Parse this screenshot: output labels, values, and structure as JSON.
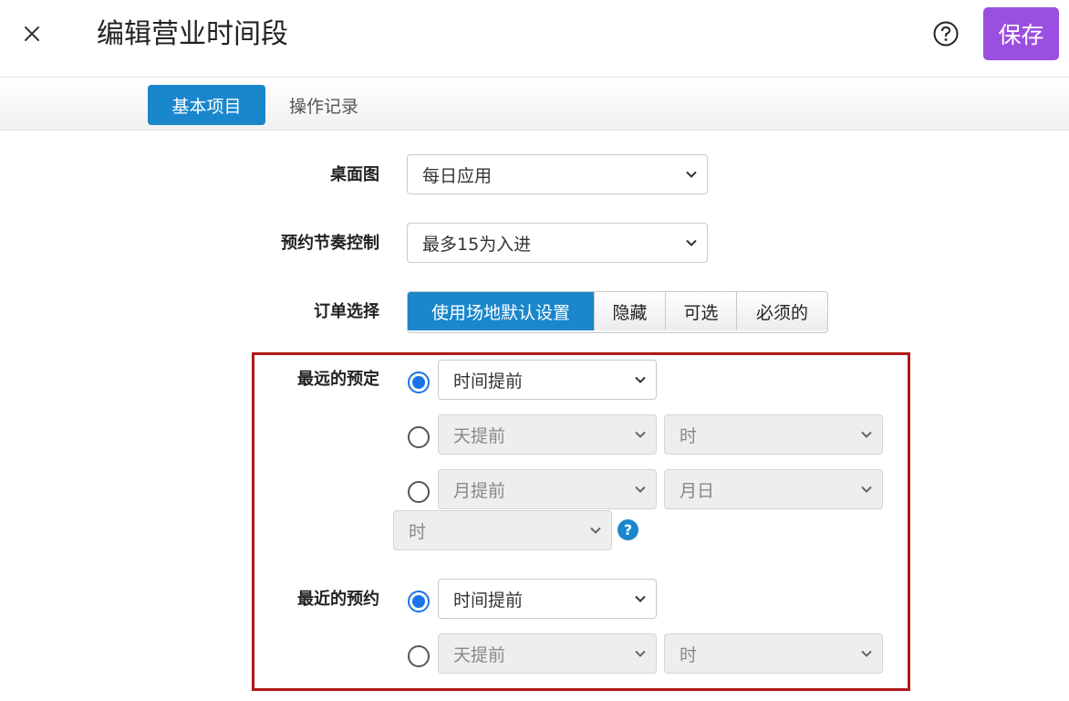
{
  "header": {
    "title": "编辑营业时间段",
    "save_label": "保存"
  },
  "tabs": [
    {
      "label": "基本项目",
      "active": true
    },
    {
      "label": "操作记录",
      "active": false
    }
  ],
  "form": {
    "desktop_view": {
      "label": "桌面图",
      "value": "每日应用"
    },
    "booking_pace": {
      "label": "预约节奏控制",
      "value": "最多15为入进"
    },
    "order_select": {
      "label": "订单选择",
      "options": [
        "使用场地默认设置",
        "隐藏",
        "可选",
        "必须的"
      ],
      "selected": "使用场地默认设置"
    },
    "latest_booking": {
      "label": "最远的预定",
      "option1": {
        "value": "时间提前"
      },
      "option2": {
        "days": "天提前",
        "hour": "时"
      },
      "option3": {
        "months": "月提前",
        "month_day": "月日",
        "hour": "时"
      }
    },
    "earliest_booking": {
      "label": "最近的预约",
      "option1": {
        "value": "时间提前"
      },
      "option2": {
        "days": "天提前",
        "hour": "时"
      }
    }
  },
  "colors": {
    "accent": "#1a86cc",
    "save": "#9b4fe0",
    "highlight_border": "#b01a1a",
    "radio": "#1a73e8"
  },
  "icons": [
    "close-icon",
    "help-icon",
    "chevron-down-icon",
    "info-icon"
  ]
}
